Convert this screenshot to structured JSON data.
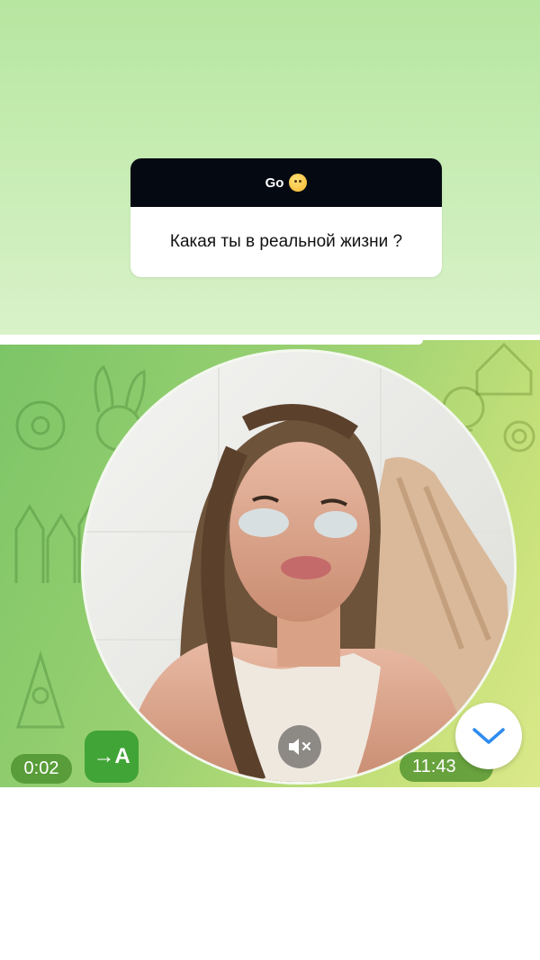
{
  "question_card": {
    "header_text": "Go",
    "header_emoji": "hugging-face-emoji",
    "question_text": "Какая ты в реальной жизни ?"
  },
  "video_message": {
    "duration": "0:02",
    "timestamp": "11:43",
    "translate_label": "→A",
    "mute_icon": "speaker-muted-icon",
    "scroll_icon": "chevron-down-icon"
  },
  "colors": {
    "top_background": "#c6ecb2",
    "question_header": "#050a12",
    "chat_green": "#7cc567",
    "chat_yellow": "#dbe98a",
    "translate_button": "#41a437",
    "scroll_chevron": "#2f8cf0"
  }
}
